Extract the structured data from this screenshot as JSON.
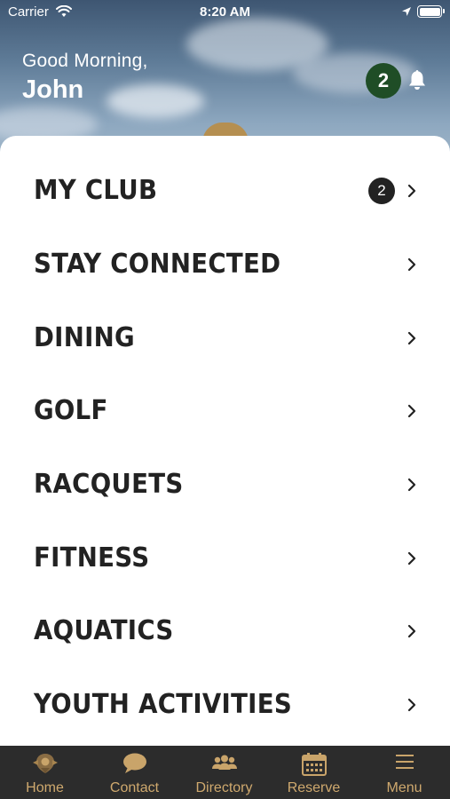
{
  "status_bar": {
    "carrier": "Carrier",
    "time": "8:20 AM"
  },
  "header": {
    "greeting": "Good Morning,",
    "name": "John",
    "notification_count": "2"
  },
  "menu": [
    {
      "label": "MY CLUB",
      "badge": "2"
    },
    {
      "label": "STAY CONNECTED"
    },
    {
      "label": "DINING"
    },
    {
      "label": "GOLF"
    },
    {
      "label": "RACQUETS"
    },
    {
      "label": "FITNESS"
    },
    {
      "label": "AQUATICS"
    },
    {
      "label": "YOUTH ACTIVITIES"
    }
  ],
  "tabs": [
    {
      "label": "Home",
      "icon": "club-crest-icon"
    },
    {
      "label": "Contact",
      "icon": "chat-bubble-icon"
    },
    {
      "label": "Directory",
      "icon": "people-icon"
    },
    {
      "label": "Reserve",
      "icon": "calendar-icon"
    },
    {
      "label": "Menu",
      "icon": "hamburger-menu-icon"
    }
  ],
  "colors": {
    "tab_accent": "#cfa96e",
    "tabbar_bg": "#2c2c2c",
    "notification_badge": "#1f4d26",
    "menu_text": "#222222"
  }
}
